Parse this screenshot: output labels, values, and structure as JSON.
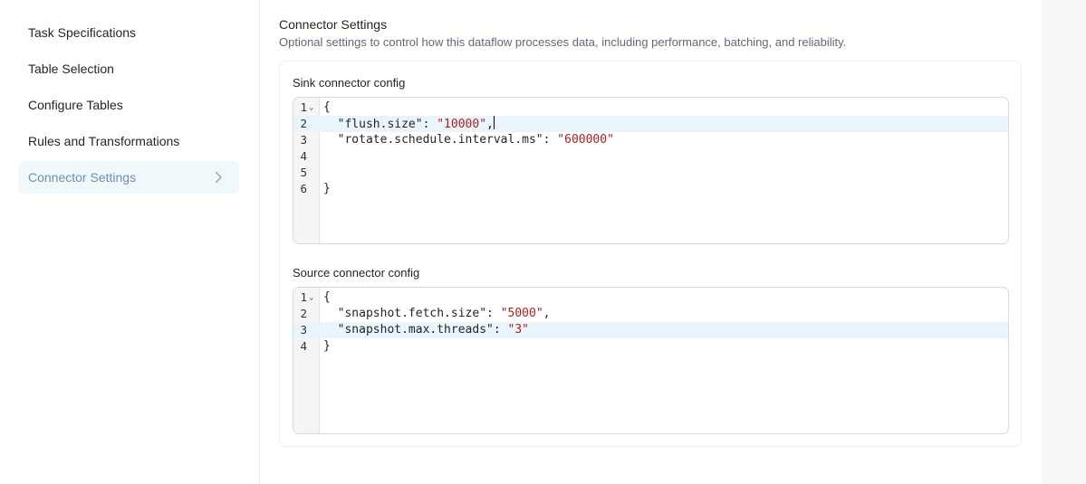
{
  "sidebar": {
    "items": [
      {
        "label": "Task Specifications"
      },
      {
        "label": "Table Selection"
      },
      {
        "label": "Configure Tables"
      },
      {
        "label": "Rules and Transformations"
      },
      {
        "label": "Connector Settings"
      }
    ],
    "active_index": 4
  },
  "main": {
    "title": "Connector Settings",
    "subtitle": "Optional settings to control how this dataflow processes data, including performance, batching, and reliability.",
    "sink": {
      "label": "Sink connector config",
      "lines": [
        {
          "num": "1",
          "text": "{"
        },
        {
          "num": "2",
          "key": "\"flush.size\"",
          "value": "\"10000\"",
          "suffix": ","
        },
        {
          "num": "3",
          "key": "\"rotate.schedule.interval.ms\"",
          "value": "\"600000\"",
          "suffix": ""
        },
        {
          "num": "4",
          "text": ""
        },
        {
          "num": "5",
          "text": ""
        },
        {
          "num": "6",
          "text": "}"
        }
      ]
    },
    "source": {
      "label": "Source connector config",
      "lines": [
        {
          "num": "1",
          "text": "{"
        },
        {
          "num": "2",
          "key": "\"snapshot.fetch.size\"",
          "value": "\"5000\"",
          "suffix": ","
        },
        {
          "num": "3",
          "key": "\"snapshot.max.threads\"",
          "value": "\"3\"",
          "suffix": ""
        },
        {
          "num": "4",
          "text": "}"
        }
      ]
    }
  },
  "colors": {
    "active_bg": "#f0f8fc",
    "active_text": "#6e8fa8",
    "string": "#b31d1d",
    "highlight_line": "#eaf5fb"
  },
  "icons": {
    "active_chevron": "chevron-right-icon",
    "fold": "chevron-down-icon"
  }
}
